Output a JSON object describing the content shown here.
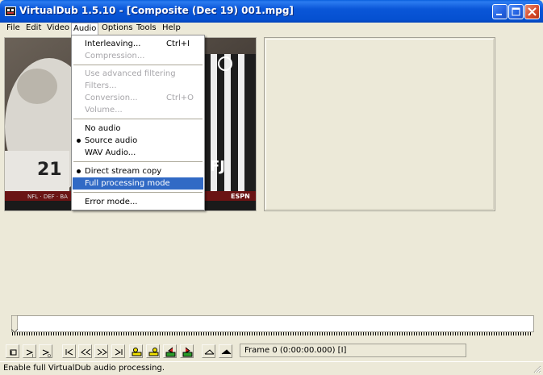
{
  "window": {
    "title": "VirtualDub 1.5.10 - [Composite (Dec 19) 001.mpg]"
  },
  "menubar": {
    "items": [
      "File",
      "Edit",
      "Video",
      "Audio",
      "Options",
      "Tools",
      "Help"
    ],
    "active": "Audio"
  },
  "audio_menu": {
    "items": [
      {
        "label": "Interleaving...",
        "shortcut": "Ctrl+I",
        "enabled": true
      },
      {
        "label": "Compression...",
        "enabled": false
      },
      {
        "label": "Use advanced filtering",
        "enabled": false
      },
      {
        "label": "Filters...",
        "enabled": false
      },
      {
        "label": "Conversion...",
        "shortcut": "Ctrl+O",
        "enabled": false
      },
      {
        "label": "Volume...",
        "enabled": false
      },
      {
        "label": "No audio",
        "enabled": true
      },
      {
        "label": "Source audio",
        "enabled": true,
        "checked": true
      },
      {
        "label": "WAV Audio...",
        "enabled": true
      },
      {
        "label": "Direct stream copy",
        "enabled": true,
        "checked": true
      },
      {
        "label": "Full processing mode",
        "enabled": true,
        "highlighted": true
      },
      {
        "label": "Error mode...",
        "enabled": true
      }
    ]
  },
  "video_overlay": {
    "jersey_number": "21",
    "jersey_letters": "FJ",
    "ticker_left": "NFL · DEF · BA",
    "network_logo": "ESPN"
  },
  "toolbar": {
    "buttons": [
      "stop-icon",
      "play-input-icon",
      "play-output-icon",
      "start-icon",
      "back-key-icon",
      "prev-frame-icon",
      "next-frame-icon",
      "end-icon",
      "prev-keyframe-icon",
      "next-keyframe-icon",
      "scene-back-icon",
      "scene-forward-icon",
      "mark-in-icon",
      "mark-out-icon"
    ],
    "frame_label": "Frame 0 (0:00:00.000) [I]"
  },
  "statusbar": {
    "text": "Enable full VirtualDub audio processing."
  },
  "colors": {
    "titlebar": "#0a56d8",
    "menu_highlight": "#316ac5",
    "face": "#ece9d8"
  }
}
